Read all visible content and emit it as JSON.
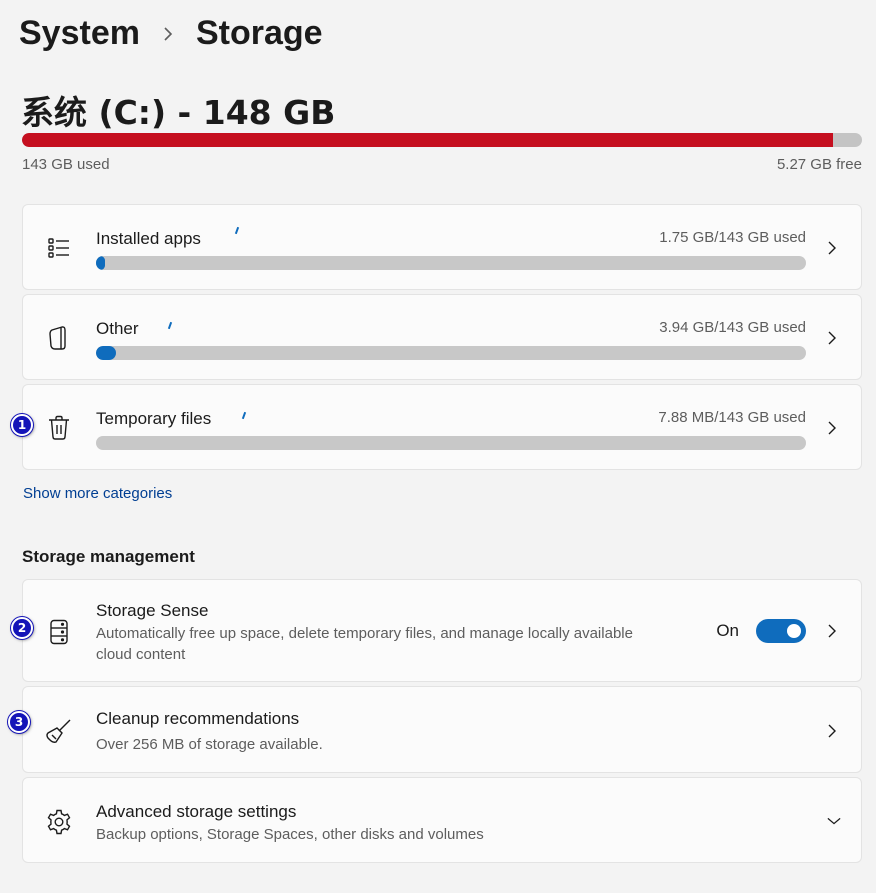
{
  "breadcrumb": {
    "parent": "System",
    "current": "Storage"
  },
  "drive": {
    "title": "系统 (C:) - 148 GB",
    "used_label": "143 GB used",
    "free_label": "5.27 GB free",
    "used_fraction": 0.966,
    "bar_color": "#c50f1f"
  },
  "categories": [
    {
      "label": "Installed apps",
      "amount": "1.75 GB/143 GB used",
      "icon": "app-list-icon",
      "fraction": 0.012
    },
    {
      "label": "Other",
      "amount": "3.94 GB/143 GB used",
      "icon": "document-icon",
      "fraction": 0.028
    },
    {
      "label": "Temporary files",
      "amount": "7.88 MB/143 GB used",
      "icon": "trash-icon",
      "fraction": 0.0
    }
  ],
  "show_more": "Show more categories",
  "management": {
    "title": "Storage management",
    "storage_sense": {
      "title": "Storage Sense",
      "desc_line1": "Automatically free up space, delete temporary files, and manage locally available",
      "desc_line2": "cloud content",
      "toggle_label": "On",
      "toggle_on": true
    },
    "cleanup": {
      "title": "Cleanup recommendations",
      "desc": "Over 256 MB of storage available."
    },
    "advanced": {
      "title": "Advanced storage settings",
      "desc": "Backup options, Storage Spaces, other disks and volumes"
    }
  },
  "markers": [
    "1",
    "2",
    "3"
  ],
  "colors": {
    "accent": "#0f6cbd",
    "link": "#003e92",
    "marker": "#1414b8"
  }
}
